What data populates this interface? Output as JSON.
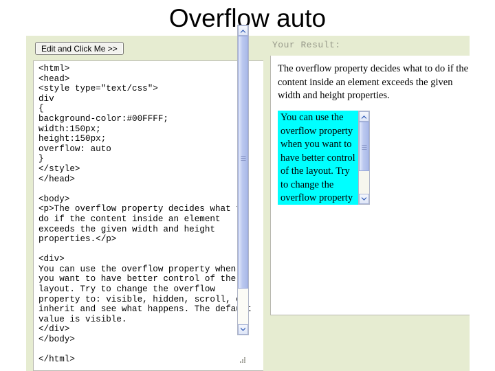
{
  "slide": {
    "title": "Overflow auto"
  },
  "editor": {
    "button_label": "Edit and Click Me >>",
    "code": "<html>\n<head>\n<style type=\"text/css\">\ndiv\n{\nbackground-color:#00FFFF;\nwidth:150px;\nheight:150px;\noverflow: auto\n}\n</style>\n</head>\n\n<body>\n<p>The overflow property decides what to do if the content inside an element exceeds the given width and height properties.</p>\n\n<div>\nYou can use the overflow property when you want to have better control of the layout. Try to change the overflow property to: visible, hidden, scroll, or inherit and see what happens. The default value is visible.\n</div>\n</body>\n\n</html>",
    "scrollbar": {
      "up_arrow_icon": "chevron-up-icon",
      "down_arrow_icon": "chevron-down-icon"
    }
  },
  "result": {
    "label": "Your Result:",
    "paragraph": "The overflow property decides what to do if the content inside an element exceeds the given width and height properties.",
    "overflow_box_text": "You can use the overflow property when you want to have better control of the layout. Try to change the overflow property to: visible, hidden, scroll, or inherit and see what happens. The default value is visible.",
    "overflow_box_color": "#00FFFF",
    "scrollbar": {
      "up_arrow_icon": "chevron-up-icon",
      "down_arrow_icon": "chevron-down-icon"
    }
  },
  "colors": {
    "panel_background": "#E6ECD1",
    "result_box": "#00FFFF",
    "page_background": "#FFFFFF",
    "label_text": "#97998A"
  }
}
